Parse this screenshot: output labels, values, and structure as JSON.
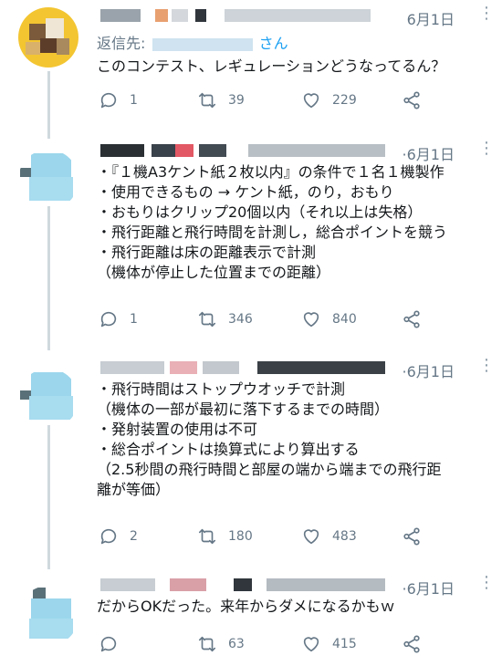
{
  "tweets": [
    {
      "date": "6月1日",
      "reply_prefix": "返信先:",
      "reply_suffix": "さん",
      "text": "このコンテスト、レギュレーションどうなってるん？",
      "replies": "1",
      "retweets": "39",
      "likes": "229"
    },
    {
      "date": "6月1日",
      "text": "・『１機A3ケント紙２枚以内』の条件で１名１機製作\n・使用できるもの → ケント紙，のり，おもり\n・おもりはクリップ20個以内（それ以上は失格）\n・飛行距離と飛行時間を計測し，総合ポイントを競う\n・飛行距離は床の距離表示で計測\n（機体が停止した位置までの距離）",
      "replies": "1",
      "retweets": "346",
      "likes": "840"
    },
    {
      "date": "6月1日",
      "text": "・飛行時間はストップウオッチで計測\n（機体の一部が最初に落下するまでの時間）\n・発射装置の使用は不可\n・総合ポイントは換算式により算出する\n（2.5秒間の飛行時間と部屋の端から端までの飛行距\n離が等価）",
      "replies": "2",
      "retweets": "180",
      "likes": "483"
    },
    {
      "date": "6月1日",
      "text": "だからOKだった。来年からダメになるかもｗ",
      "replies": "",
      "retweets": "63",
      "likes": "415"
    }
  ],
  "colors": {
    "muted": "#657786",
    "link": "#1da1f2",
    "avatar_yellow": "#f3c531",
    "avatar_blue": "#9bd6ec"
  }
}
